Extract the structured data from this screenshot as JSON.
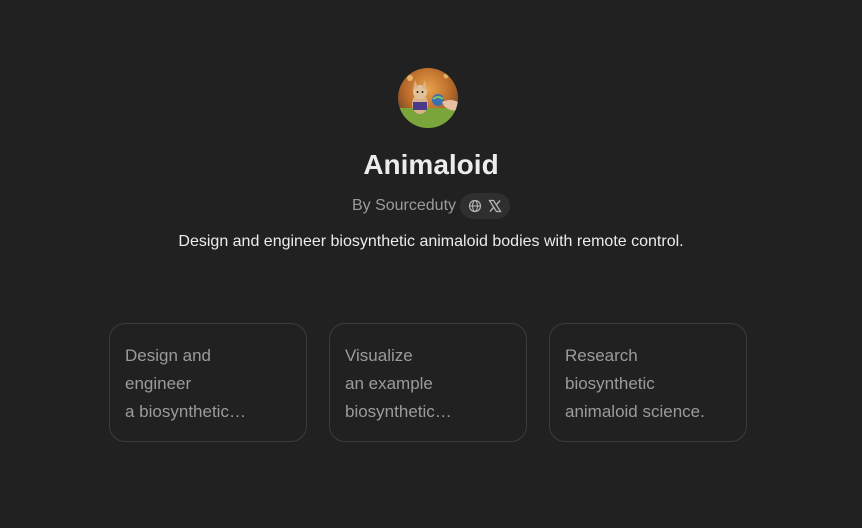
{
  "gpt": {
    "name": "Animaloid",
    "byline": "By Sourceduty",
    "description": "Design and engineer biosynthetic animaloid bodies with remote control.",
    "avatar_icon": "animaloid-avatar",
    "links": [
      "globe-icon",
      "x-logo-icon"
    ]
  },
  "starters": [
    {
      "lines": [
        "Design and",
        "engineer",
        "a biosynthetic…"
      ]
    },
    {
      "lines": [
        "Visualize",
        "an example",
        "biosynthetic…"
      ]
    },
    {
      "lines": [
        "Research",
        "biosynthetic",
        "animaloid science."
      ]
    }
  ],
  "colors": {
    "background": "#212121",
    "title": "#ececec",
    "muted": "#9b9b9b",
    "card_border": "#3c3c3c",
    "pill": "#2f2f2f"
  }
}
